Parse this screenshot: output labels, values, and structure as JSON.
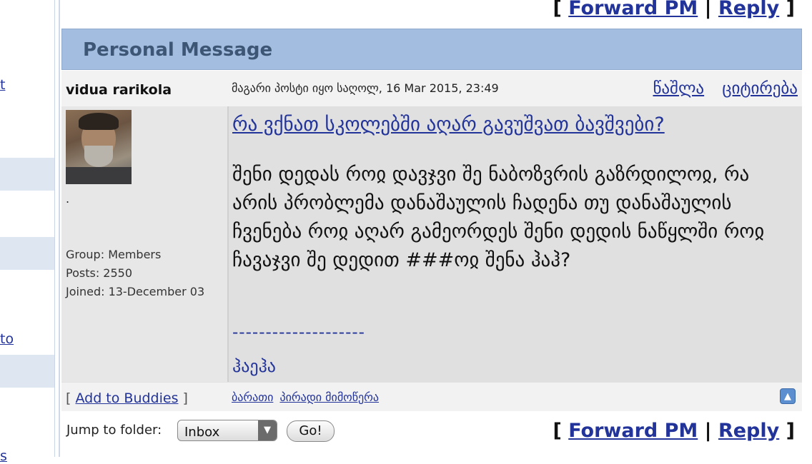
{
  "sidebar": {
    "links": [
      "t",
      "to",
      "s"
    ]
  },
  "actions": {
    "open": "[",
    "forward": "Forward PM",
    "sep": "|",
    "reply": "Reply",
    "close": "]"
  },
  "header": {
    "title": "Personal Message"
  },
  "post": {
    "author": "vidua rarikola",
    "meta": "მაგარი პოსტი იყო საღოლ, 16 Mar 2015, 23:49",
    "delete_label": "წაშლა",
    "quote_label": "ციტირება",
    "subject": "რა ვქნათ სკოლებში აღარ გავუშვათ ბავშვები?",
    "body": "შენი დედას როჲ დავჯვი შე ნაბოზვრის გაზრდილოჲ, რა არის პრობლემა დანაშაულის ჩადენა თუ დანაშაულის ჩვენება როჲ აღარ გამეორდეს შენი დედის ნაწყლში როჲ ჩავაჯვი შე დედით ###ოჲ შენა ჰაჰ?",
    "sig_line": "--------------------",
    "sig_text": "ჰაეჰა"
  },
  "user": {
    "dot": ".",
    "group": "Group: Members",
    "posts": "Posts: 2550",
    "joined": "Joined: 13-December 03"
  },
  "footer": {
    "buddies_open": "[",
    "add_buddies": "Add to Buddies",
    "buddies_close": "]",
    "card": "ბარათი",
    "private_msg": "პირადი მიმოწერა"
  },
  "jump": {
    "label": "Jump to folder:",
    "selected": "Inbox",
    "go": "Go!"
  },
  "colors": {
    "link": "#22339a",
    "header_bg": "#a2bde0",
    "header_text": "#3d5675"
  }
}
